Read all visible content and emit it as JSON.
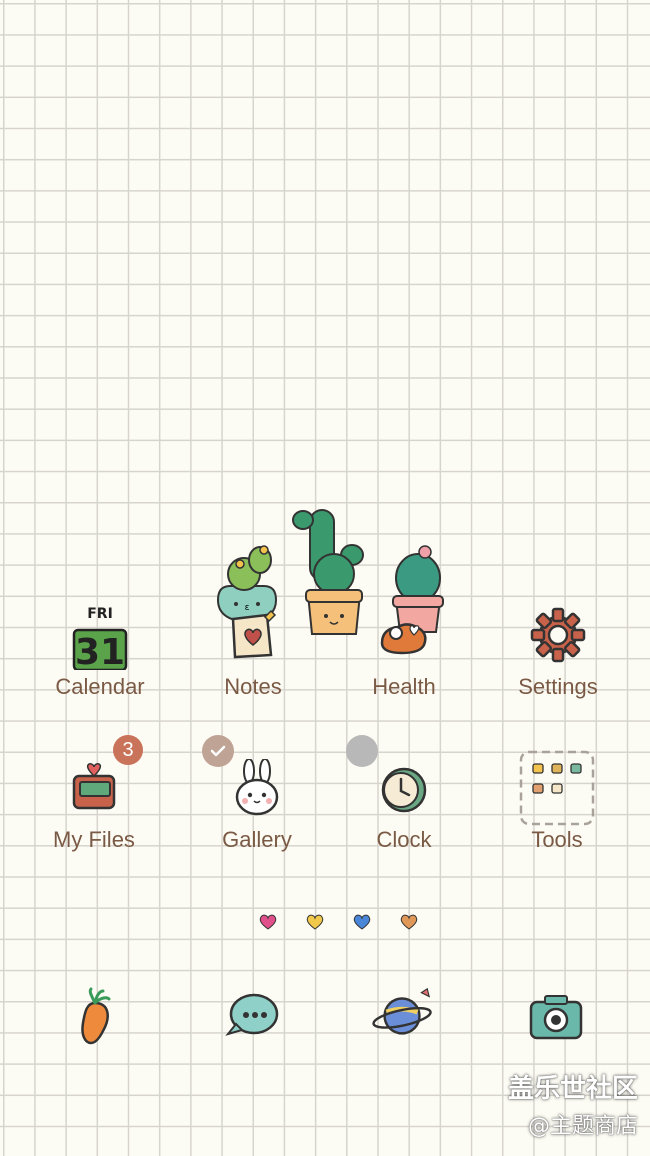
{
  "widget": {
    "name": "cactus-pots-widget"
  },
  "apps_row1": [
    {
      "label": "Calendar",
      "icon": "calendar-icon",
      "day": "FRI",
      "date": "31"
    },
    {
      "label": "Notes",
      "icon": "notes-icon"
    },
    {
      "label": "Health",
      "icon": "health-icon"
    },
    {
      "label": "Settings",
      "icon": "gear-icon"
    }
  ],
  "apps_row2": [
    {
      "label": "My Files",
      "icon": "folder-icon",
      "badge": "3"
    },
    {
      "label": "Gallery",
      "icon": "bunny-gallery-icon"
    },
    {
      "label": "Clock",
      "icon": "clock-icon"
    },
    {
      "label": "Tools",
      "icon": "tools-folder-icon"
    }
  ],
  "badges": {
    "files_count": "3",
    "gallery_check": "checkmark-icon",
    "clock_dot": "grey-dot"
  },
  "page_indicators": [
    "heart-pink",
    "heart-yellow",
    "heart-blue",
    "heart-orange"
  ],
  "dock": [
    {
      "icon": "carrot-phone-icon"
    },
    {
      "icon": "chat-bubble-icon"
    },
    {
      "icon": "planet-browser-icon"
    },
    {
      "icon": "camera-icon"
    }
  ],
  "watermark": {
    "line1": "盖乐世社区",
    "line2": "@主题商店"
  },
  "colors": {
    "label": "#7a5a45",
    "grid": "#d6d4cc",
    "background": "#fdfcf4",
    "badge": "#c9735a"
  }
}
